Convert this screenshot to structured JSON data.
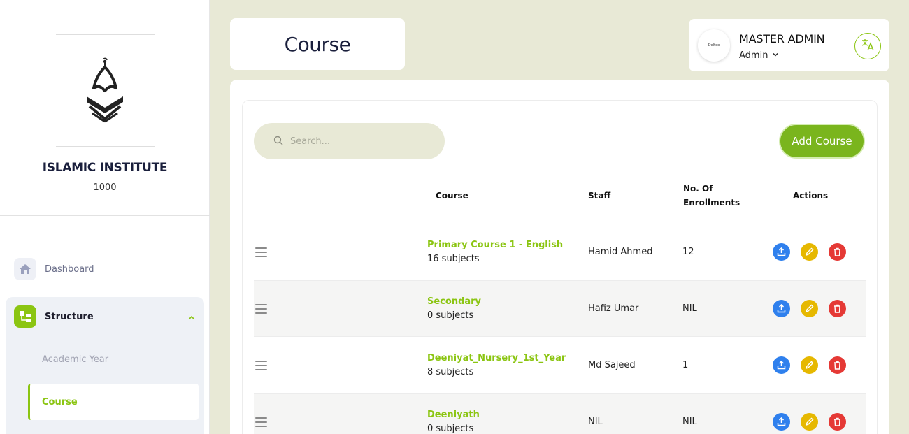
{
  "sidebar": {
    "institute_name": "ISLAMIC INSTITUTE",
    "institute_code": "1000",
    "nav": {
      "dashboard": "Dashboard",
      "structure": "Structure",
      "academic_year": "Academic Year",
      "course": "Course"
    }
  },
  "header": {
    "page_title": "Course",
    "user": {
      "avatar_text": "Deltoo",
      "name": "MASTER ADMIN",
      "role": "Admin"
    }
  },
  "toolbar": {
    "search_placeholder": "Search...",
    "add_button": "Add Course"
  },
  "table": {
    "headers": {
      "course": "Course",
      "staff": "Staff",
      "enrollments_line1": "No. Of",
      "enrollments_line2": "Enrollments",
      "actions": "Actions"
    },
    "rows": [
      {
        "name": "Primary Course 1 - English",
        "subjects": "16 subjects",
        "staff": "Hamid Ahmed",
        "enrollments": "12"
      },
      {
        "name": "Secondary",
        "subjects": "0 subjects",
        "staff": "Hafiz Umar",
        "enrollments": "NIL"
      },
      {
        "name": "Deeniyat_Nursery_1st_Year",
        "subjects": "8 subjects",
        "staff": "Md Sajeed",
        "enrollments": "1"
      },
      {
        "name": "Deeniyath",
        "subjects": "0 subjects",
        "staff": "NIL",
        "enrollments": "NIL"
      }
    ]
  },
  "colors": {
    "accent": "#8bc512",
    "background": "#e8e9d6",
    "upload": "#2f80ed",
    "edit": "#e6b800",
    "delete": "#e53935"
  }
}
